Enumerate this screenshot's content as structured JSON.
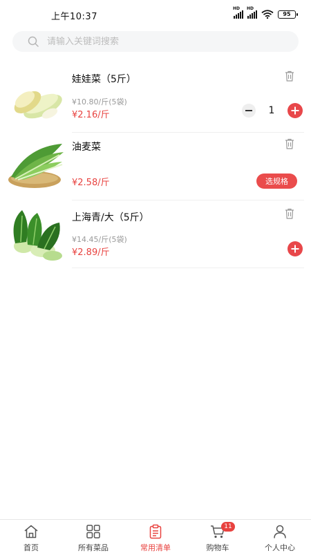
{
  "status_bar": {
    "time": "上午10:37",
    "battery": "95",
    "hd_label": "HD"
  },
  "search": {
    "placeholder": "请输入关键词搜索"
  },
  "products": [
    {
      "name": "娃娃菜（5斤）",
      "unit_price": "¥10.80/斤(5袋)",
      "price": "¥2.16/斤",
      "quantity": "1",
      "image_icon": "napa-cabbage-image"
    },
    {
      "name": "油麦菜",
      "price": "¥2.58/斤",
      "spec_button": "选规格",
      "image_icon": "lettuce-image"
    },
    {
      "name": "上海青/大（5斤）",
      "unit_price": "¥14.45/斤(5袋)",
      "price": "¥2.89/斤",
      "image_icon": "bok-choy-image"
    }
  ],
  "tab_bar": {
    "items": [
      {
        "label": "首页",
        "icon": "home-icon"
      },
      {
        "label": "所有菜品",
        "icon": "grid-icon"
      },
      {
        "label": "常用清单",
        "icon": "clipboard-icon",
        "active": true
      },
      {
        "label": "购物车",
        "icon": "cart-icon",
        "badge": "11"
      },
      {
        "label": "个人中心",
        "icon": "person-icon"
      }
    ]
  },
  "colors": {
    "accent": "#e8423f",
    "muted_text": "#999999",
    "search_bg": "#f5f6f7"
  }
}
